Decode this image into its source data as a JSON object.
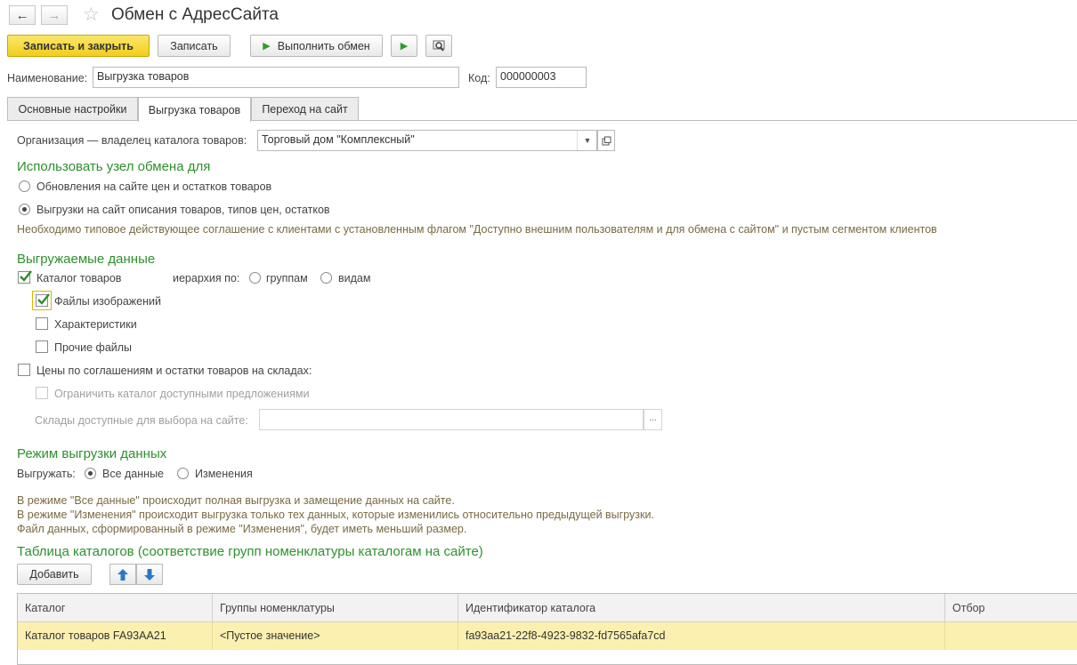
{
  "window": {
    "title": "Обмен с АдресСайта"
  },
  "toolbar": {
    "save_close_label": "Записать и закрыть",
    "save_label": "Записать",
    "run_exchange_label": "Выполнить обмен"
  },
  "form": {
    "name_label": "Наименование:",
    "name_value": "Выгрузка товаров",
    "code_label": "Код:",
    "code_value": "000000003"
  },
  "tabs": [
    {
      "label": "Основные настройки",
      "active": false
    },
    {
      "label": "Выгрузка товаров",
      "active": true
    },
    {
      "label": "Переход на сайт",
      "active": false
    }
  ],
  "organization": {
    "label": "Организация — владелец каталога товаров:",
    "value": "Торговый дом \"Комплексный\""
  },
  "use_node": {
    "title": "Использовать узел обмена для",
    "option1": "Обновления на сайте цен и остатков товаров",
    "option2": "Выгрузки на сайт описания товаров, типов цен, остатков",
    "selected": 2,
    "note": "Необходимо типовое действующее соглашение с клиентами с установленным флагом \"Доступно внешним пользователям и для обмена с сайтом\" и пустым сегментом клиентов"
  },
  "exported_data": {
    "title": "Выгружаемые данные",
    "catalog_label": "Каталог товаров",
    "catalog_checked": true,
    "hierarchy_label": "иерархия по:",
    "hierarchy_groups": "группам",
    "hierarchy_kinds": "видам",
    "images_label": "Файлы изображений",
    "images_checked": true,
    "characteristics_label": "Характеристики",
    "other_files_label": "Прочие файлы",
    "prices_label": "Цены по соглашениям и остатки товаров на складах:",
    "limit_label": "Ограничить каталог доступными предложениями",
    "warehouses_label": "Склады доступные для выбора на сайте:",
    "warehouses_button": "..."
  },
  "mode": {
    "title": "Режим выгрузки данных",
    "export_label": "Выгружать:",
    "all_data": "Все данные",
    "changes": "Изменения",
    "selected": "all",
    "note_line1": "В режиме \"Все данные\" происходит полная выгрузка  и замещение данных на сайте.",
    "note_line2": "В режиме \"Изменения\" происходит выгрузка только тех данных, которые изменились относительно предыдущей выгрузки.",
    "note_line3": "Файл данных, сформированный в режиме \"Изменения\", будет иметь меньший размер."
  },
  "catalog_table": {
    "title": "Таблица каталогов (соответствие групп номенклатуры каталогам на сайте)",
    "add_label": "Добавить",
    "columns": [
      "Каталог",
      "Группы номенклатуры",
      "Идентификатор каталога",
      "Отбор"
    ],
    "rows": [
      [
        "Каталог товаров FA93AA21",
        "<Пустое значение>",
        "fa93aa21-22f8-4923-9832-fd7565afa7cd",
        ""
      ]
    ]
  },
  "colors": {
    "section_green": "#2f8f2f",
    "primary_button": "#f2cd1b",
    "selected_row": "#fbf0b0",
    "play_green": "#2e9c2e",
    "arrow_blue": "#2a78c8"
  }
}
